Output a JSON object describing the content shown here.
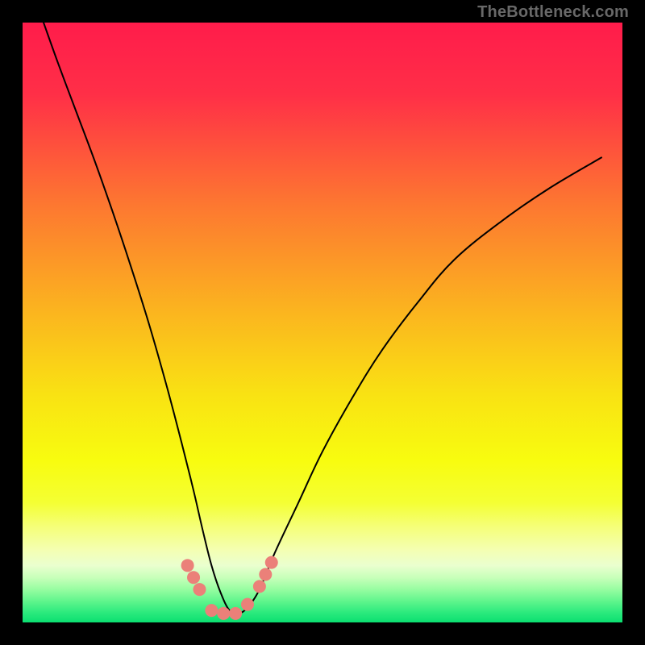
{
  "watermark": "TheBottleneck.com",
  "chart_data": {
    "type": "line",
    "title": "",
    "xlabel": "",
    "ylabel": "",
    "xlim": [
      0,
      1
    ],
    "ylim": [
      0,
      1
    ],
    "background_gradient": {
      "stops": [
        {
          "offset": 0.0,
          "color": "#ff1c4b"
        },
        {
          "offset": 0.12,
          "color": "#ff2f47"
        },
        {
          "offset": 0.3,
          "color": "#fd7631"
        },
        {
          "offset": 0.48,
          "color": "#fbb41f"
        },
        {
          "offset": 0.62,
          "color": "#f9e213"
        },
        {
          "offset": 0.73,
          "color": "#f8fc0f"
        },
        {
          "offset": 0.8,
          "color": "#f4ff33"
        },
        {
          "offset": 0.84,
          "color": "#f5ff78"
        },
        {
          "offset": 0.88,
          "color": "#f4ffb3"
        },
        {
          "offset": 0.905,
          "color": "#eaffcf"
        },
        {
          "offset": 0.925,
          "color": "#c8ffba"
        },
        {
          "offset": 0.945,
          "color": "#97fda1"
        },
        {
          "offset": 0.965,
          "color": "#5ef58c"
        },
        {
          "offset": 0.985,
          "color": "#28e97c"
        },
        {
          "offset": 1.0,
          "color": "#0bdf71"
        }
      ]
    },
    "series": [
      {
        "name": "bottleneck-curve",
        "stroke": "#000000",
        "stroke_width": 2,
        "x": [
          0.035,
          0.06,
          0.09,
          0.12,
          0.15,
          0.18,
          0.21,
          0.24,
          0.265,
          0.285,
          0.3,
          0.315,
          0.33,
          0.345,
          0.36,
          0.375,
          0.395,
          0.42,
          0.46,
          0.5,
          0.55,
          0.6,
          0.66,
          0.72,
          0.8,
          0.88,
          0.965
        ],
        "y": [
          1.0,
          0.93,
          0.85,
          0.77,
          0.685,
          0.595,
          0.5,
          0.395,
          0.3,
          0.22,
          0.155,
          0.095,
          0.05,
          0.02,
          0.015,
          0.025,
          0.055,
          0.115,
          0.2,
          0.285,
          0.375,
          0.455,
          0.535,
          0.605,
          0.67,
          0.725,
          0.775
        ]
      }
    ],
    "markers": {
      "name": "highlighted-points",
      "fill": "#eb8079",
      "radius": 8,
      "x": [
        0.275,
        0.285,
        0.295,
        0.315,
        0.335,
        0.355,
        0.375,
        0.395,
        0.405,
        0.415
      ],
      "y": [
        0.095,
        0.075,
        0.055,
        0.02,
        0.015,
        0.015,
        0.03,
        0.06,
        0.08,
        0.1
      ]
    }
  }
}
